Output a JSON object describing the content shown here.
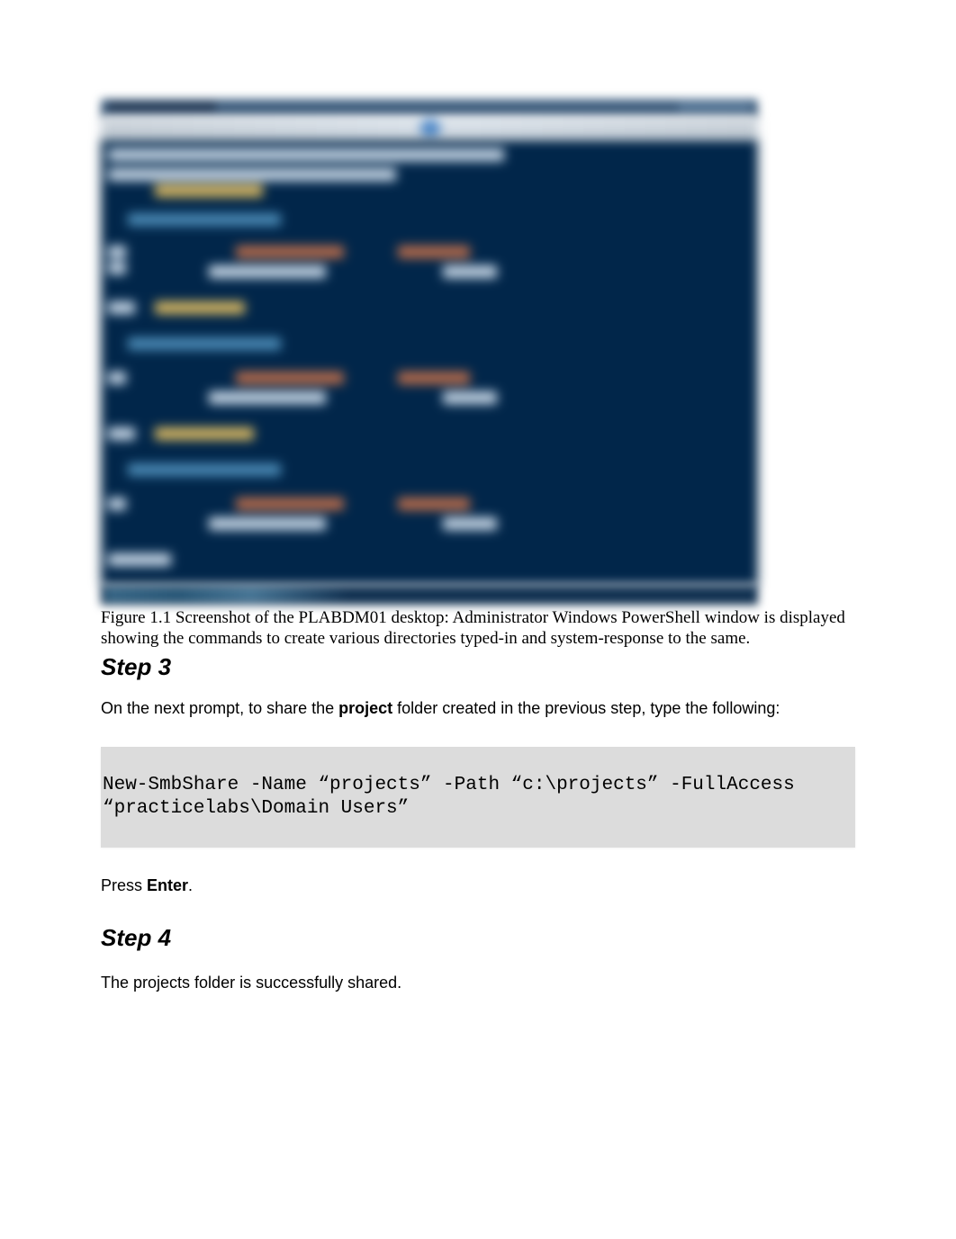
{
  "figure": {
    "caption": "Figure 1.1 Screenshot of the PLABDM01 desktop: Administrator Windows PowerShell window is displayed showing the commands to create various directories typed-in and system-response to the same."
  },
  "step3": {
    "heading": "Step 3",
    "intro_pre": "On the next prompt, to share the ",
    "intro_bold": "project",
    "intro_post": " folder created in the previous step, type the following:",
    "code": "New-SmbShare -Name “projects” -Path “c:\\projects” -FullAccess “practicelabs\\Domain Users”",
    "press_pre": "Press ",
    "press_bold": "Enter",
    "press_post": "."
  },
  "step4": {
    "heading": "Step 4",
    "text": "The projects folder is successfully shared."
  }
}
